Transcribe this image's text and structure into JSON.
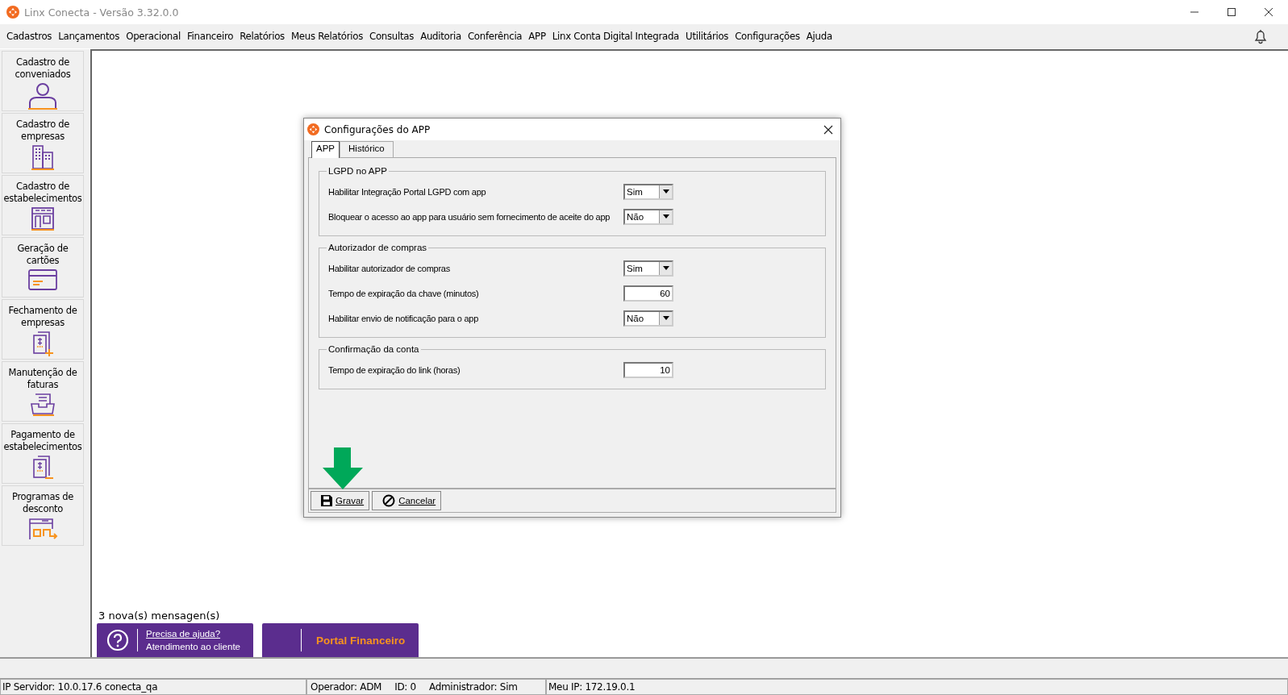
{
  "window": {
    "title": "Linx Conecta - Versão 3.32.0.0"
  },
  "menu": [
    "Cadastros",
    "Lançamentos",
    "Operacional",
    "Financeiro",
    "Relatórios",
    "Meus Relatórios",
    "Consultas",
    "Auditoria",
    "Conferência",
    "APP",
    "Linx Conta Digital Integrada",
    "Utilitários",
    "Configurações",
    "Ajuda"
  ],
  "sidebar": {
    "items": [
      {
        "label": "Cadastro de conveniados",
        "kind": "person"
      },
      {
        "label": "Cadastro de empresas",
        "kind": "buildings"
      },
      {
        "label": "Cadastro de estabelecimentos",
        "kind": "store"
      },
      {
        "label": "Geração de cartões",
        "kind": "card"
      },
      {
        "label": "Fechamento de empresas",
        "kind": "invoice-plus"
      },
      {
        "label": "Manutenção de faturas",
        "kind": "tray"
      },
      {
        "label": "Pagamento de estabelecimentos",
        "kind": "invoice-minus"
      },
      {
        "label": "Programas de desconto",
        "kind": "window"
      }
    ]
  },
  "dialog": {
    "title": "Configurações do APP",
    "tabs": [
      {
        "label": "APP",
        "selected": true
      },
      {
        "label": "Histórico",
        "selected": false
      }
    ],
    "groups": [
      {
        "title": "LGPD no APP",
        "fields": [
          {
            "label": "Habilitar Integração Portal LGPD com app",
            "kind": "select",
            "value": "Sim"
          },
          {
            "label": "Bloquear o acesso ao app para usuário sem fornecimento de aceite do app",
            "kind": "select",
            "value": "Não"
          }
        ]
      },
      {
        "title": "Autorizador de compras",
        "fields": [
          {
            "label": "Habilitar autorizador de compras",
            "kind": "select",
            "value": "Sim"
          },
          {
            "label": "Tempo de expiração da chave (minutos)",
            "kind": "input",
            "value": "60"
          },
          {
            "label": "Habilitar envio de notificação para o app",
            "kind": "select",
            "value": "Não"
          }
        ]
      },
      {
        "title": "Confirmação da conta",
        "fields": [
          {
            "label": "Tempo de expiração do link (horas)",
            "kind": "input",
            "value": "10"
          }
        ]
      }
    ],
    "buttons": [
      {
        "label": "Gravar",
        "kind": "save"
      },
      {
        "label": "Cancelar",
        "kind": "cancel"
      }
    ]
  },
  "messages": "3 nova(s) mensagen(s)",
  "help": {
    "link": "Precisa de ajuda?",
    "subtitle": "Atendimento ao cliente"
  },
  "portal": {
    "label": "Portal Financeiro"
  },
  "status_bar": [
    [
      "IP Servidor: 10.0.17.6 conecta_qa"
    ],
    [
      "Operador: ADM",
      "ID: 0",
      "Administrador: Sim"
    ],
    [
      "Meu IP: 172.19.0.1"
    ]
  ]
}
